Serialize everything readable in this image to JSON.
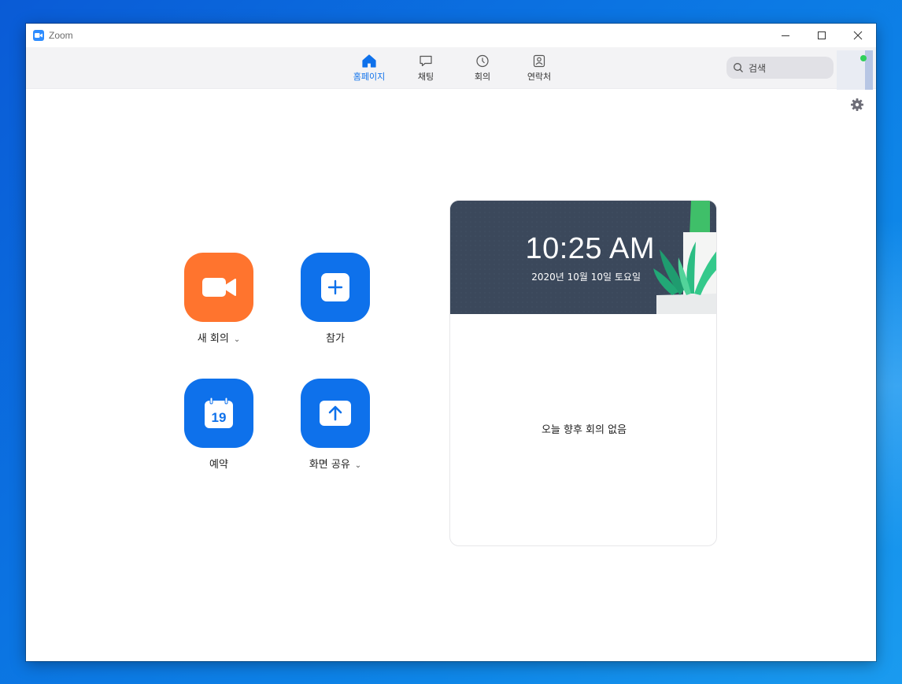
{
  "window": {
    "title": "Zoom",
    "controls": [
      {
        "name": "minimize-button",
        "icon": "minimize-icon"
      },
      {
        "name": "maximize-button",
        "icon": "maximize-icon"
      },
      {
        "name": "close-button",
        "icon": "close-icon"
      }
    ]
  },
  "nav": {
    "items": [
      {
        "label": "홈페이지",
        "icon": "home-icon",
        "active": true
      },
      {
        "label": "채팅",
        "icon": "chat-icon",
        "active": false
      },
      {
        "label": "회의",
        "icon": "clock-icon",
        "active": false
      },
      {
        "label": "연락처",
        "icon": "contacts-icon",
        "active": false
      }
    ],
    "active_color": "#0e71eb"
  },
  "search": {
    "placeholder": "검색"
  },
  "actions": [
    {
      "label": "새 회의",
      "icon": "video-camera-icon",
      "color": "#ff742e",
      "has_dropdown": true
    },
    {
      "label": "참가",
      "icon": "plus-icon",
      "color": "#0e71eb",
      "has_dropdown": false
    },
    {
      "label": "예약",
      "icon": "calendar-icon",
      "calendar_day": "19",
      "color": "#0e71eb",
      "has_dropdown": false
    },
    {
      "label": "화면 공유",
      "icon": "share-up-arrow-icon",
      "color": "#0e71eb",
      "has_dropdown": true
    }
  ],
  "meeting_card": {
    "time": "10:25 AM",
    "date": "2020년 10월 10일 토요일",
    "empty_message": "오늘 향후 회의 없음"
  },
  "colors": {
    "brand_blue": "#0e71eb",
    "brand_orange": "#ff742e",
    "status_online": "#2fd05a"
  }
}
